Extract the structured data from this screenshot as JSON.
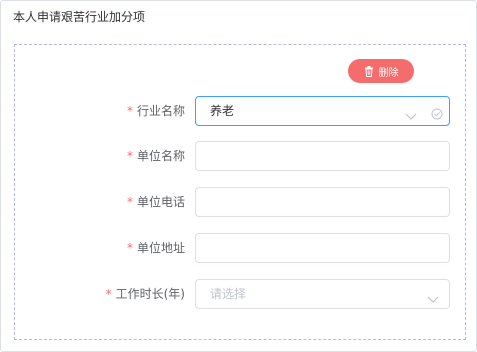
{
  "section": {
    "title": "本人申请艰苦行业加分项"
  },
  "actions": {
    "delete_label": "删除",
    "delete_icon": "trash-icon",
    "delete_color": "#f56c6c"
  },
  "form": {
    "required_mark": "*",
    "industry": {
      "label": "行业名称",
      "value": "养老"
    },
    "unit_name": {
      "label": "单位名称",
      "value": ""
    },
    "unit_phone": {
      "label": "单位电话",
      "value": ""
    },
    "unit_address": {
      "label": "单位地址",
      "value": ""
    },
    "work_years": {
      "label": "工作时长(年)",
      "placeholder": "请选择"
    }
  },
  "colors": {
    "required": "#f56c6c",
    "focus_border": "#409eff",
    "dashed_border": "#b7b7ee"
  }
}
